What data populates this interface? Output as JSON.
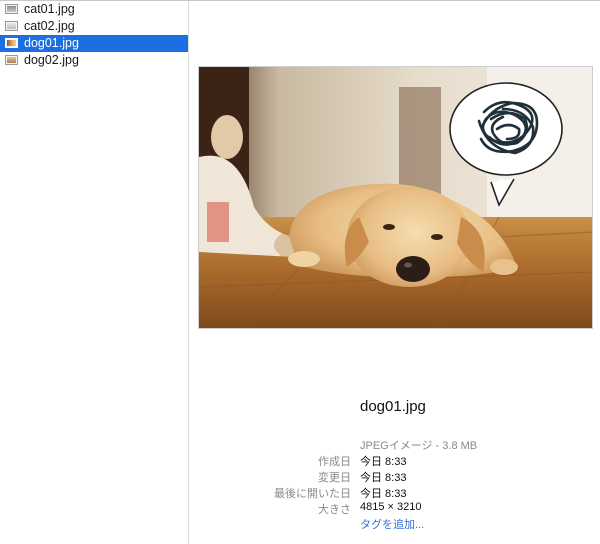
{
  "files": [
    {
      "name": "cat01.jpg",
      "icon": "jpg-thumbnail-icon",
      "selected": false
    },
    {
      "name": "cat02.jpg",
      "icon": "jpg-thumbnail-icon",
      "selected": false
    },
    {
      "name": "dog01.jpg",
      "icon": "jpg-thumbnail-icon",
      "selected": true
    },
    {
      "name": "dog02.jpg",
      "icon": "jpg-thumbnail-icon",
      "selected": false
    }
  ],
  "preview": {
    "image_subject": "puppy-photo",
    "file_name": "dog01.jpg",
    "kind": "JPEGイメージ - 3.8 MB",
    "rows": [
      {
        "label": "作成日",
        "value": "今日 8:33"
      },
      {
        "label": "変更日",
        "value": "今日 8:33"
      },
      {
        "label": "最後に開いた日",
        "value": "今日 8:33"
      },
      {
        "label": "大きさ",
        "value": "4815 × 3210"
      }
    ],
    "add_tag_label": "タグを追加..."
  },
  "colors": {
    "selection": "#1c6fe0",
    "link": "#2f6fd6",
    "label_gray": "#8a8a8a"
  }
}
